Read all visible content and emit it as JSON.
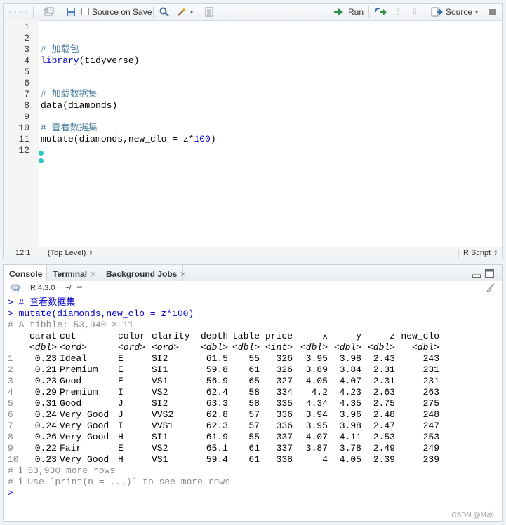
{
  "toolbar": {
    "source_on_save_label": "Source on Save",
    "run_label": "Run",
    "source_label": "Source"
  },
  "editor": {
    "lines": [
      {
        "num": "1",
        "text": "",
        "kind": "plain"
      },
      {
        "num": "2",
        "text": "",
        "kind": "plain"
      },
      {
        "num": "3",
        "text": "# 加载包",
        "kind": "comment"
      },
      {
        "num": "4",
        "fn": "library",
        "arg": "(tidyverse)",
        "kind": "call"
      },
      {
        "num": "5",
        "text": "",
        "kind": "plain"
      },
      {
        "num": "6",
        "text": "",
        "kind": "plain"
      },
      {
        "num": "7",
        "text": "# 加载数据集",
        "kind": "comment"
      },
      {
        "num": "8",
        "text": "data(diamonds)",
        "kind": "plain"
      },
      {
        "num": "9",
        "text": "",
        "kind": "plain"
      },
      {
        "num": "10",
        "text": "# 查看数据集",
        "kind": "comment"
      },
      {
        "num": "11",
        "pre": "mutate(diamonds,new_clo = z*",
        "num_val": "100",
        "post": ")",
        "kind": "mutate"
      },
      {
        "num": "12",
        "text": "",
        "kind": "plain"
      }
    ],
    "status": {
      "position": "12:1",
      "scope": "(Top Level)",
      "file_type": "R Script"
    }
  },
  "console": {
    "tabs": [
      {
        "label": "Console",
        "active": true
      },
      {
        "label": "Terminal",
        "active": false
      },
      {
        "label": "Background Jobs",
        "active": false
      }
    ],
    "r_version": "R 4.3.0",
    "working_dir": "~/",
    "prompt_lines": [
      "> # 查看数据集",
      "> mutate(diamonds,new_clo = z*100)"
    ],
    "tibble_header": "# A tibble: 53,940 × 11",
    "columns": [
      "carat",
      "cut",
      "color",
      "clarity",
      "depth",
      "table",
      "price",
      "x",
      "y",
      "z",
      "new_clo"
    ],
    "types": [
      "<dbl>",
      "<ord>",
      "<ord>",
      "<ord>",
      "<dbl>",
      "<dbl>",
      "<int>",
      "<dbl>",
      "<dbl>",
      "<dbl>",
      "<dbl>"
    ],
    "rows": [
      [
        "1",
        "0.23",
        "Ideal",
        "E",
        "SI2",
        "61.5",
        "55",
        "326",
        "3.95",
        "3.98",
        "2.43",
        "243"
      ],
      [
        "2",
        "0.21",
        "Premium",
        "E",
        "SI1",
        "59.8",
        "61",
        "326",
        "3.89",
        "3.84",
        "2.31",
        "231"
      ],
      [
        "3",
        "0.23",
        "Good",
        "E",
        "VS1",
        "56.9",
        "65",
        "327",
        "4.05",
        "4.07",
        "2.31",
        "231"
      ],
      [
        "4",
        "0.29",
        "Premium",
        "I",
        "VS2",
        "62.4",
        "58",
        "334",
        "4.2",
        "4.23",
        "2.63",
        "263"
      ],
      [
        "5",
        "0.31",
        "Good",
        "J",
        "SI2",
        "63.3",
        "58",
        "335",
        "4.34",
        "4.35",
        "2.75",
        "275"
      ],
      [
        "6",
        "0.24",
        "Very Good",
        "J",
        "VVS2",
        "62.8",
        "57",
        "336",
        "3.94",
        "3.96",
        "2.48",
        "248"
      ],
      [
        "7",
        "0.24",
        "Very Good",
        "I",
        "VVS1",
        "62.3",
        "57",
        "336",
        "3.95",
        "3.98",
        "2.47",
        "247"
      ],
      [
        "8",
        "0.26",
        "Very Good",
        "H",
        "SI1",
        "61.9",
        "55",
        "337",
        "4.07",
        "4.11",
        "2.53",
        "253"
      ],
      [
        "9",
        "0.22",
        "Fair",
        "E",
        "VS2",
        "65.1",
        "61",
        "337",
        "3.87",
        "3.78",
        "2.49",
        "249"
      ],
      [
        "10",
        "0.23",
        "Very Good",
        "H",
        "VS1",
        "59.4",
        "61",
        "338",
        "4",
        "4.05",
        "2.39",
        "239"
      ]
    ],
    "footer_lines": [
      "# ℹ 53,930 more rows",
      "# ℹ Use `print(n = ...)` to see more rows"
    ],
    "final_prompt": ">"
  },
  "watermark": "CSDN @M冰",
  "colors": {
    "comment": "#4d7f9e",
    "function": "#0000cc",
    "prompt": "#0000cc",
    "muted": "#8a8a8a"
  }
}
